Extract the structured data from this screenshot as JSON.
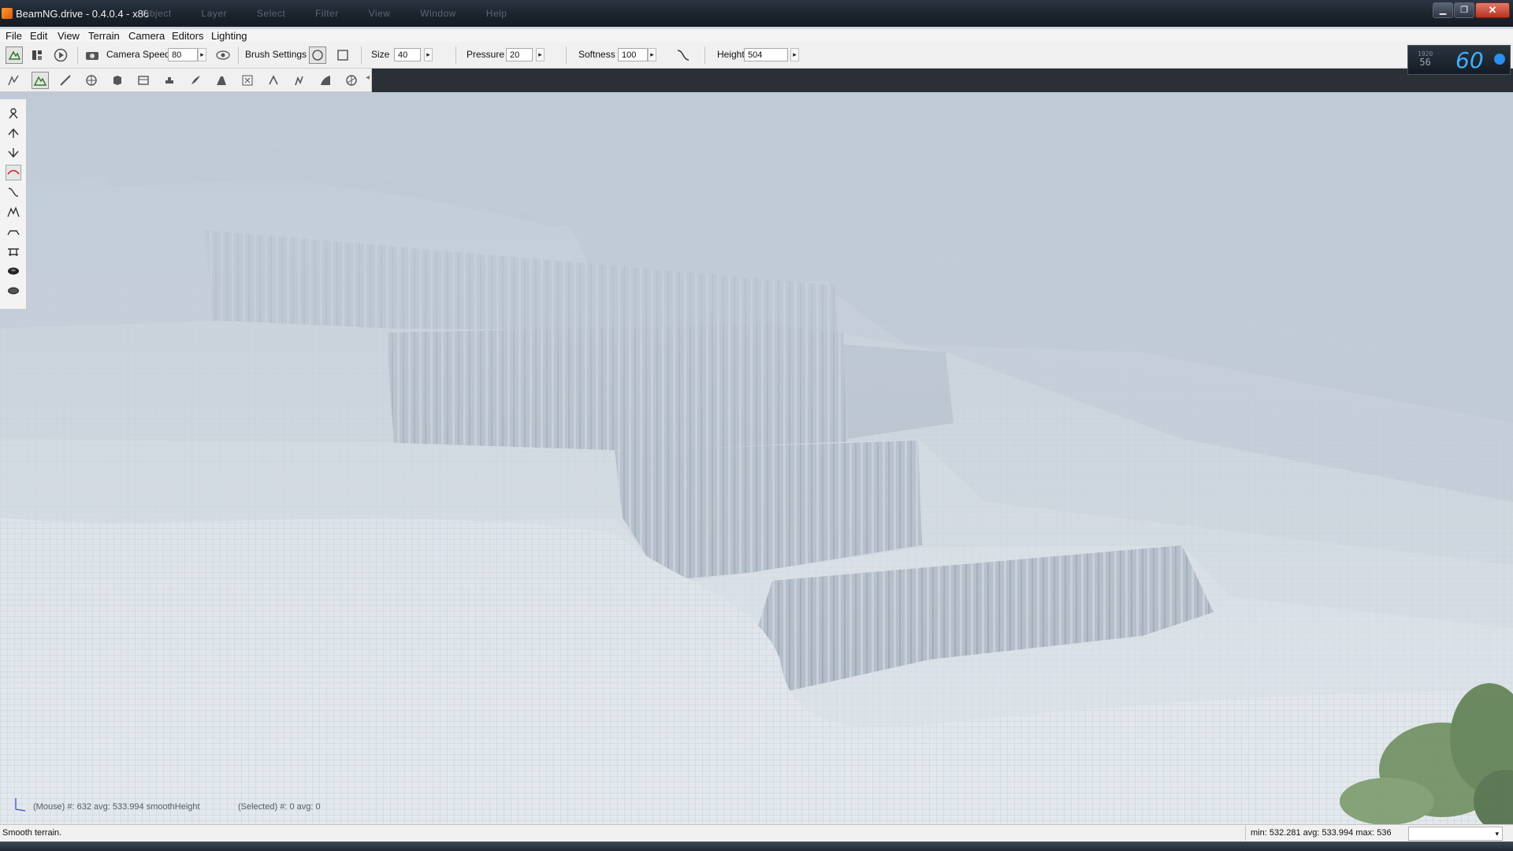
{
  "window": {
    "title": "BeamNG.drive - 0.4.0.4 - x86",
    "ghost_menu": [
      "Object",
      "Layer",
      "Select",
      "Filter",
      "View",
      "Window",
      "Help"
    ],
    "controls": {
      "minimize": "▁",
      "restore": "❐",
      "close": "✕"
    }
  },
  "menubar": {
    "items": [
      "File",
      "Edit",
      "View",
      "Terrain",
      "Camera",
      "Editors",
      "Lighting"
    ]
  },
  "toolbar": {
    "camera_speed_label": "Camera Speed",
    "camera_speed_value": "80",
    "brush_settings_label": "Brush Settings",
    "size_label": "Size",
    "size_value": "40",
    "pressure_label": "Pressure",
    "pressure_value": "20",
    "softness_label": "Softness",
    "softness_value": "100",
    "height_label": "Height",
    "height_value": "504",
    "arrow": "▸"
  },
  "fps": {
    "small_top": "1920",
    "small_value": "56",
    "value": "60"
  },
  "viewport": {
    "mouse_info": "(Mouse) #: 632  avg: 533.994 smoothHeight",
    "selected_info": "(Selected) #: 0  avg: 0"
  },
  "statusbar": {
    "message": "Smooth terrain.",
    "stats": "min: 532.281  avg: 533.994  max: 536",
    "combo_arrow": "▾"
  },
  "colors": {
    "titlebar": "#1c232d",
    "menubar": "#f4f4f4",
    "fog": "#d7dee6",
    "fps_digits": "#3fb0ff",
    "active_tool": "#d4201a"
  }
}
